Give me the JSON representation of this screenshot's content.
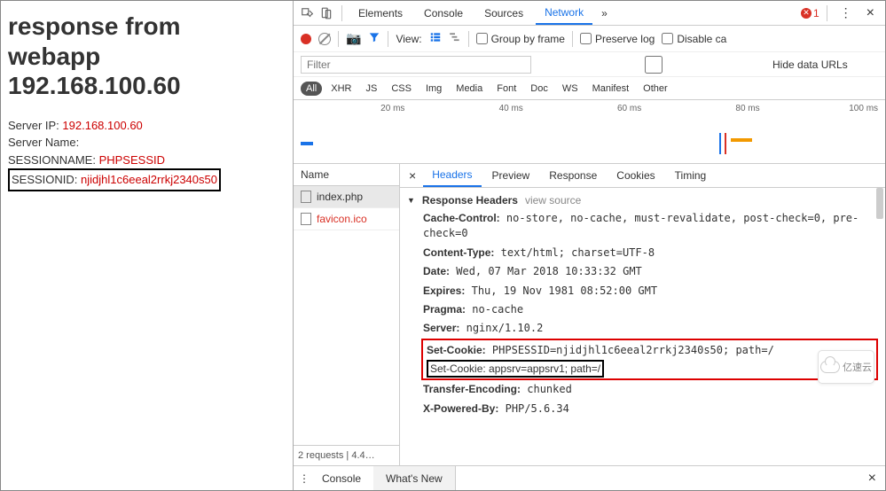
{
  "page": {
    "title_line1": "response from",
    "title_line2": "webapp",
    "title_line3": "192.168.100.60",
    "server_ip_label": "Server IP: ",
    "server_ip": "192.168.100.60",
    "server_name_label": "Server Name: ",
    "server_name": "",
    "sessionname_label": "SESSIONNAME: ",
    "sessionname": "PHPSESSID",
    "sessionid_label": "SESSIONID: ",
    "sessionid": "njidjhl1c6eeal2rrkj2340s50"
  },
  "devtools": {
    "tabs": {
      "elements": "Elements",
      "console": "Console",
      "sources": "Sources",
      "network": "Network",
      "more": "»"
    },
    "error_count": "1",
    "toolbar": {
      "view_label": "View:",
      "group_by_frame": "Group by frame",
      "preserve_log": "Preserve log",
      "disable_ca": "Disable ca"
    },
    "filter": {
      "placeholder": "Filter",
      "hide_data_urls": "Hide data URLs"
    },
    "types": {
      "all": "All",
      "xhr": "XHR",
      "js": "JS",
      "css": "CSS",
      "img": "Img",
      "media": "Media",
      "font": "Font",
      "doc": "Doc",
      "ws": "WS",
      "manifest": "Manifest",
      "other": "Other"
    },
    "timeline": [
      "20 ms",
      "40 ms",
      "60 ms",
      "80 ms",
      "100 ms"
    ],
    "requests": {
      "header": "Name",
      "items": [
        {
          "name": "index.php",
          "selected": true
        },
        {
          "name": "favicon.ico",
          "selected": false
        }
      ],
      "summary": "2 requests | 4.4…"
    },
    "detail_tabs": {
      "headers": "Headers",
      "preview": "Preview",
      "response": "Response",
      "cookies": "Cookies",
      "timing": "Timing"
    },
    "response_headers": {
      "section": "Response Headers",
      "view_source": "view source",
      "rows": {
        "cache_control_k": "Cache-Control:",
        "cache_control_v": "no-store, no-cache, must-revalidate, post-check=0, pre-check=0",
        "content_type_k": "Content-Type:",
        "content_type_v": "text/html; charset=UTF-8",
        "date_k": "Date:",
        "date_v": "Wed, 07 Mar 2018 10:33:32 GMT",
        "expires_k": "Expires:",
        "expires_v": "Thu, 19 Nov 1981 08:52:00 GMT",
        "pragma_k": "Pragma:",
        "pragma_v": "no-cache",
        "server_k": "Server:",
        "server_v": "nginx/1.10.2",
        "set_cookie1_k": "Set-Cookie:",
        "set_cookie1_v": "PHPSESSID=njidjhl1c6eeal2rrkj2340s50; path=/",
        "set_cookie2_k": "Set-Cookie:",
        "set_cookie2_v": "appsrv=appsrv1; path=/",
        "transfer_k": "Transfer-Encoding:",
        "transfer_v": "chunked",
        "xpowered_k": "X-Powered-By:",
        "xpowered_v": "PHP/5.6.34"
      }
    },
    "drawer": {
      "dots": "⋮",
      "console": "Console",
      "whats_new": "What's New",
      "close": "×"
    }
  },
  "overlay_badge": "亿速云"
}
